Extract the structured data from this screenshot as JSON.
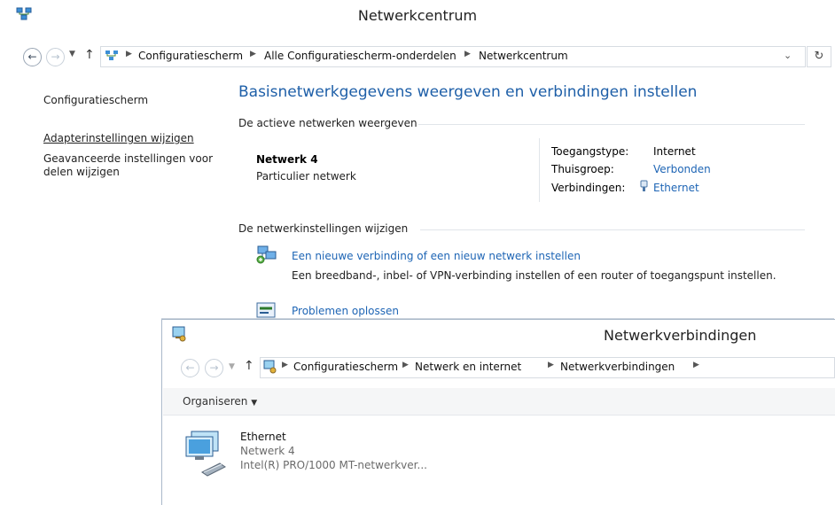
{
  "main": {
    "title": "Netwerkcentrum",
    "address": {
      "crumbs": [
        "Configuratiescherm",
        "Alle Configuratiescherm-onderdelen",
        "Netwerkcentrum"
      ],
      "dropdown": "⌄",
      "refresh": "↻"
    },
    "left": {
      "home": "Configuratiescherm",
      "adapter": "Adapterinstellingen wijzigen",
      "advanced_1": "Geavanceerde instellingen voor",
      "advanced_2": "delen wijzigen"
    },
    "heading": "Basisnetwerkgegevens weergeven en verbindingen instellen",
    "active_section": "De actieve netwerken weergeven",
    "network": {
      "name": "Netwerk 4",
      "type": "Particulier netwerk",
      "access_label": "Toegangstype:",
      "access_value": "Internet",
      "homegroup_label": "Thuisgroep:",
      "homegroup_value": "Verbonden",
      "connections_label": "Verbindingen:",
      "connections_value": "Ethernet"
    },
    "change_section": "De netwerkinstellingen wijzigen",
    "tasks": [
      {
        "title": "Een nieuwe verbinding of een nieuw netwerk instellen",
        "desc": "Een breedband-, inbel- of VPN-verbinding instellen of een router of toegangspunt instellen."
      },
      {
        "title": "Problemen oplossen",
        "desc": ""
      }
    ]
  },
  "second": {
    "title": "Netwerkverbindingen",
    "address": {
      "crumbs": [
        "Configuratiescherm",
        "Netwerk en internet",
        "Netwerkverbindingen"
      ]
    },
    "organize": "Organiseren",
    "adapter": {
      "name": "Ethernet",
      "network": "Netwerk 4",
      "device": "Intel(R) PRO/1000 MT-netwerkver..."
    }
  },
  "colors": {
    "link": "#1e65b5",
    "heading": "#1e5fa8"
  }
}
